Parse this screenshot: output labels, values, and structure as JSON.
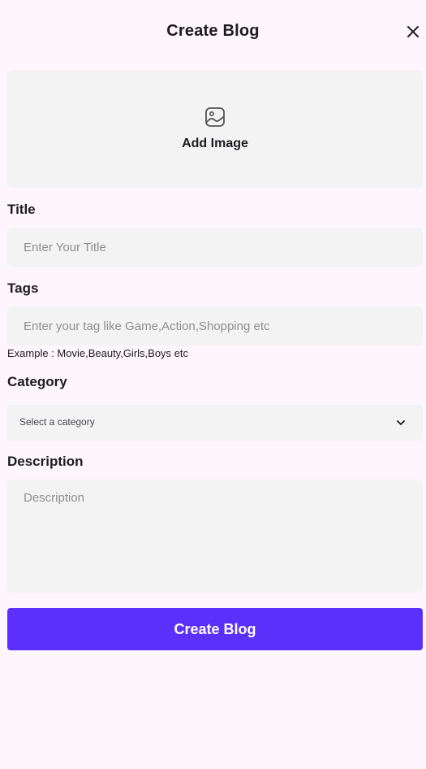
{
  "header": {
    "title": "Create Blog",
    "close_icon": "close-icon",
    "corner_glyph": "✕"
  },
  "image_picker": {
    "icon": "image-icon",
    "label": "Add Image"
  },
  "title_field": {
    "label": "Title",
    "placeholder": "Enter Your Title",
    "value": ""
  },
  "tags_field": {
    "label": "Tags",
    "placeholder": "Enter your tag like Game,Action,Shopping etc",
    "value": "",
    "example": "Example : Movie,Beauty,Girls,Boys etc"
  },
  "category_field": {
    "label": "Category",
    "selected": "Select a category",
    "icon": "chevron-down-icon"
  },
  "description_field": {
    "label": "Description",
    "placeholder": "Description",
    "value": ""
  },
  "submit": {
    "label": "Create Blog"
  },
  "colors": {
    "background": "#fdf7fd",
    "field_background": "#f3f3f3",
    "accent": "#5b30fa",
    "text": "#1c1b1f",
    "placeholder": "#8e8e8e"
  }
}
